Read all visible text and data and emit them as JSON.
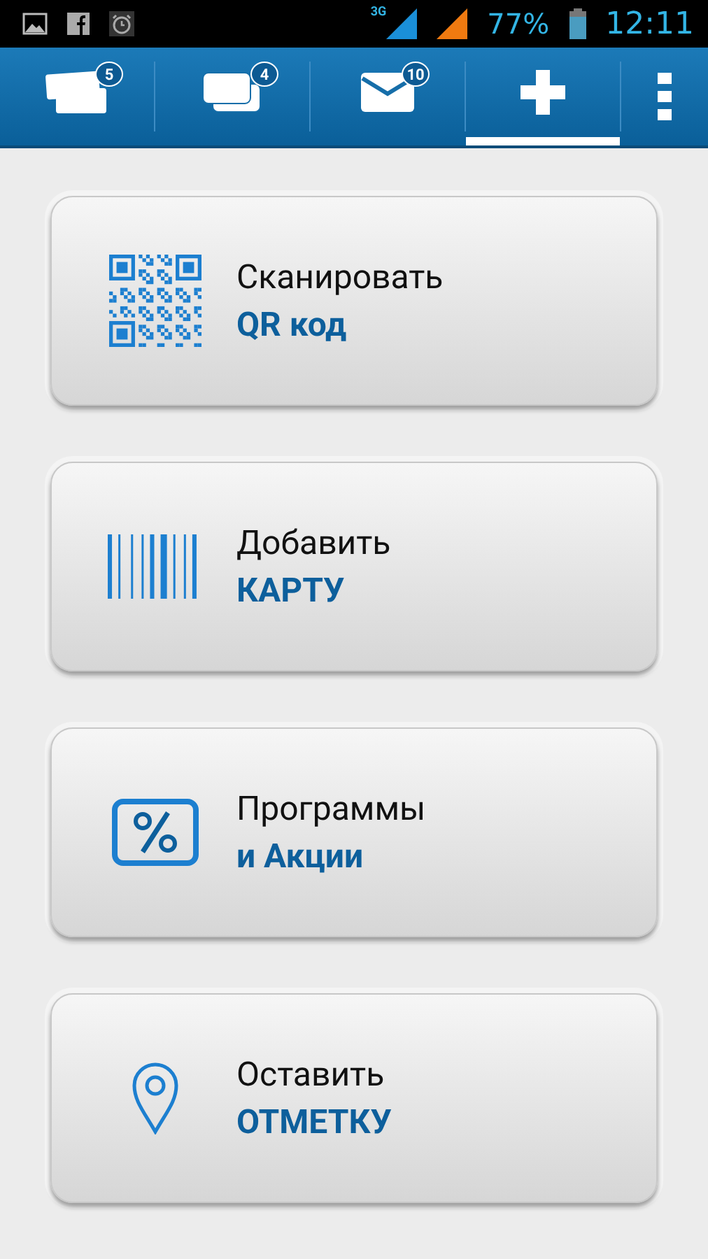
{
  "status_bar": {
    "network": "3G",
    "battery": "77%",
    "time": "12:11"
  },
  "tabs": [
    {
      "kind": "tickets",
      "badge": "5",
      "selected": false
    },
    {
      "kind": "cards",
      "badge": "4",
      "selected": false
    },
    {
      "kind": "mail",
      "badge": "10",
      "selected": false
    },
    {
      "kind": "add",
      "selected": true
    }
  ],
  "actions": [
    {
      "kind": "qr",
      "title": "Сканировать",
      "subtitle": "QR код"
    },
    {
      "kind": "barcode",
      "title": "Добавить",
      "subtitle": "КАРТУ"
    },
    {
      "kind": "percent",
      "title": "Программы",
      "subtitle": "и Акции"
    },
    {
      "kind": "pin",
      "title": "Оставить",
      "subtitle": "ОТМЕТКУ"
    }
  ]
}
